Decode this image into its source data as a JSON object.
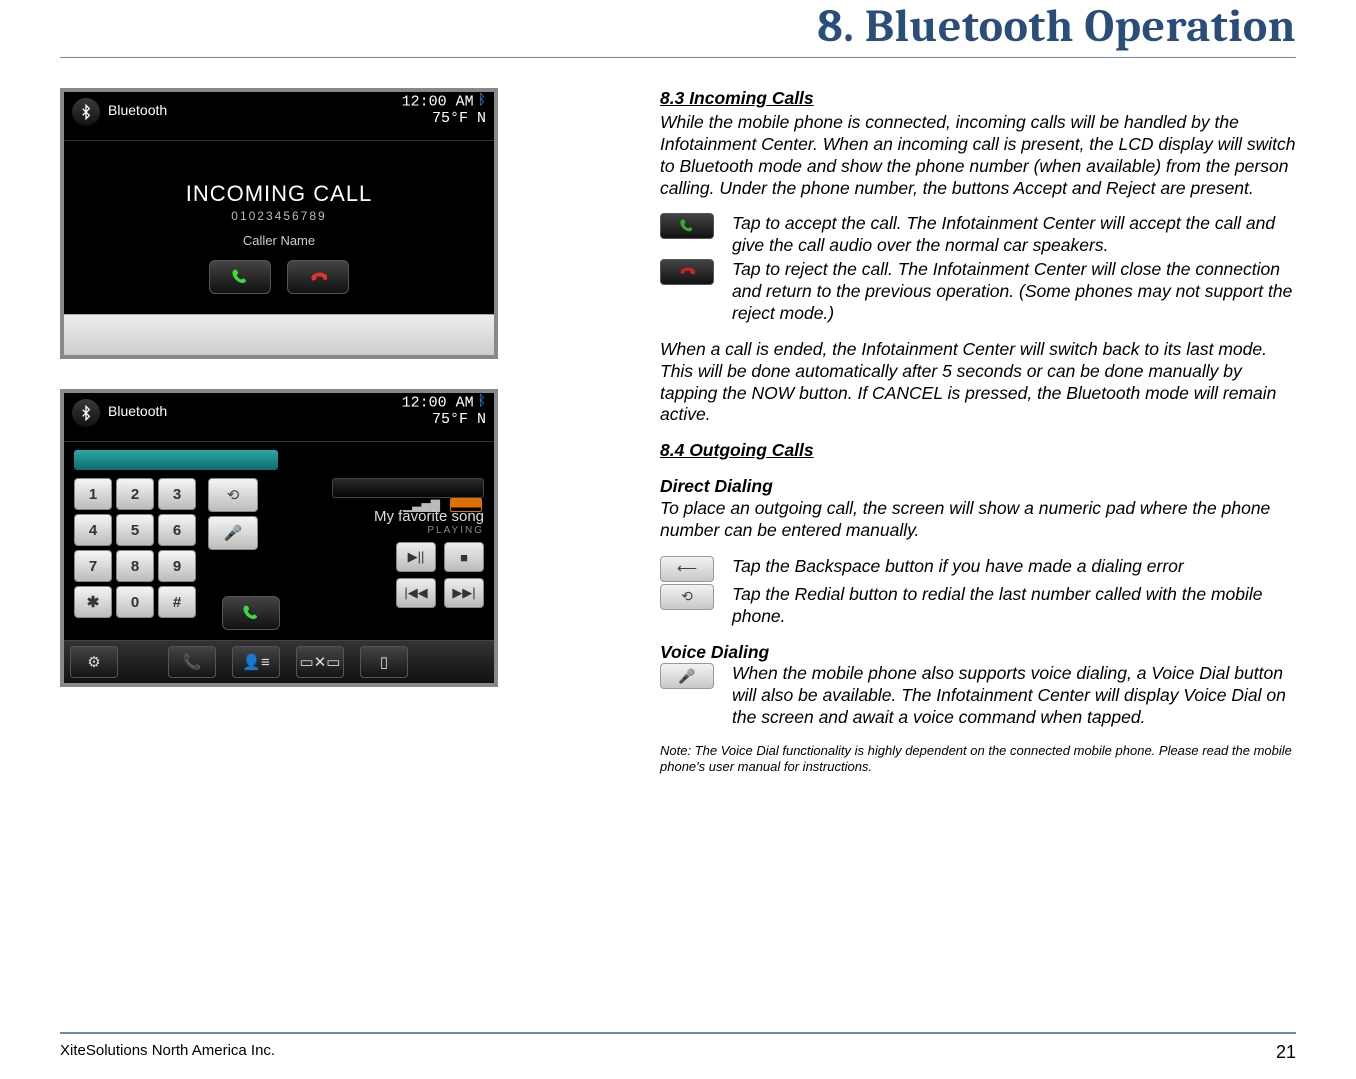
{
  "header": {
    "chapter_title": "8. Bluetooth Operation"
  },
  "screenshot1": {
    "app_label": "Bluetooth",
    "time": "12:00 AM",
    "temp_line": "75°F  N",
    "incoming_title": "INCOMING CALL",
    "incoming_number": "01023456789",
    "caller_name": "Caller Name"
  },
  "screenshot2": {
    "app_label": "Bluetooth",
    "time": "12:00 AM",
    "temp_line": "75°F  N",
    "song_title": "My favorite song",
    "playing_label": "PLAYING",
    "keys": [
      "1",
      "2",
      "3",
      "4",
      "5",
      "6",
      "7",
      "8",
      "9",
      "✱",
      "0",
      "#"
    ]
  },
  "text": {
    "s83_heading": "8.3  Incoming Calls",
    "s83_p1": "While the mobile phone is connected, incoming calls will be handled by the Infotainment Center. When an incoming call is present, the LCD display will switch to Bluetooth mode and show the phone number (when available) from the person calling. Under the phone number, the buttons Accept and Reject are present.",
    "accept_desc": "Tap to accept the call. The Infotainment Center will accept the call and give the call audio over the normal car speakers.",
    "reject_desc": "Tap to reject the call. The Infotainment Center will close the connection and return to the previous operation. (Some phones may not support the reject mode.)",
    "s83_p2": "When a call is ended, the Infotainment Center will switch back to its last mode. This will be done automatically after 5 seconds or can be done manually by tapping the NOW button. If CANCEL is pressed, the Bluetooth mode will remain active.",
    "s84_heading": "8.4  Outgoing Calls",
    "direct_heading": "Direct Dialing",
    "direct_p": "To place an outgoing call, the screen will show a numeric pad where the phone number can be entered manually.",
    "backspace_desc": "Tap the Backspace button if you have made a dialing error",
    "redial_desc": "Tap the Redial button to redial the last number called with the mobile phone.",
    "voice_heading": "Voice Dialing",
    "voice_p": "When the mobile phone also supports voice dialing, a Voice Dial button will also be available. The Infotainment Center will display Voice Dial on the screen and await a voice command when tapped.",
    "note": "Note: The Voice Dial functionality is highly dependent on the connected mobile phone. Please read the mobile phone's user manual for instructions."
  },
  "footer": {
    "company": "XiteSolutions North America Inc.",
    "page": "21"
  }
}
